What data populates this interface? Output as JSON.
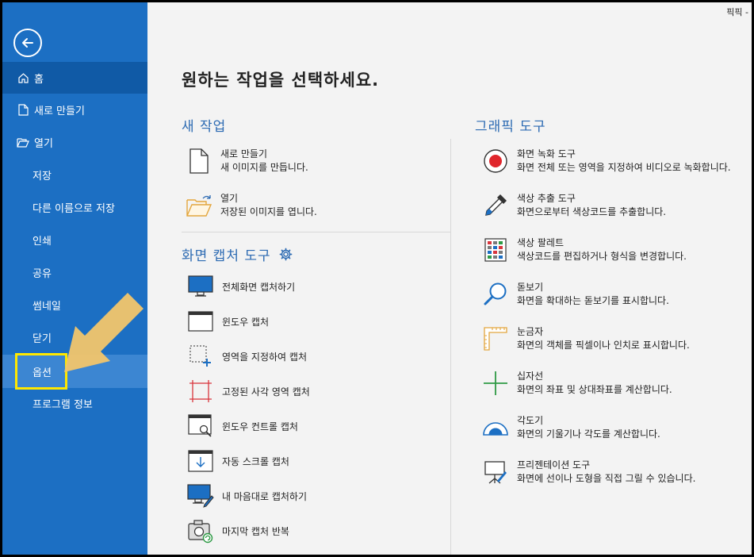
{
  "window": {
    "title": "픽픽 -"
  },
  "sidebar": {
    "items": [
      {
        "label": "홈",
        "icon": "home-icon"
      },
      {
        "label": "새로 만들기",
        "icon": "new-file-icon"
      },
      {
        "label": "열기",
        "icon": "folder-open-icon"
      },
      {
        "label": "저장"
      },
      {
        "label": "다른 이름으로 저장"
      },
      {
        "label": "인쇄"
      },
      {
        "label": "공유"
      },
      {
        "label": "썸네일"
      },
      {
        "label": "닫기"
      },
      {
        "label": "옵션"
      },
      {
        "label": "프로그램 정보"
      }
    ]
  },
  "main": {
    "page_title": "원하는 작업을 선택하세요.",
    "new_task": {
      "title": "새 작업",
      "items": [
        {
          "name": "새로 만들기",
          "desc": "새 이미지를 만듭니다."
        },
        {
          "name": "열기",
          "desc": "저장된 이미지를 엽니다."
        }
      ]
    },
    "capture": {
      "title": "화면 캡처 도구",
      "items": [
        {
          "name": "전체화면 캡처하기"
        },
        {
          "name": "윈도우 캡처"
        },
        {
          "name": "영역을 지정하여 캡처"
        },
        {
          "name": "고정된 사각 영역 캡처"
        },
        {
          "name": "윈도우 컨트롤 캡처"
        },
        {
          "name": "자동 스크롤 캡처"
        },
        {
          "name": "내 마음대로 캡처하기"
        },
        {
          "name": "마지막 캡처 반복"
        }
      ]
    },
    "graphic": {
      "title": "그래픽 도구",
      "items": [
        {
          "name": "화면 녹화 도구",
          "desc": "화면 전체 또는 영역을 지정하여 비디오로 녹화합니다."
        },
        {
          "name": "색상 추출 도구",
          "desc": "화면으로부터 색상코드를 추출합니다."
        },
        {
          "name": "색상 팔레트",
          "desc": "색상코드를 편집하거나 형식을 변경합니다."
        },
        {
          "name": "돋보기",
          "desc": "화면을 확대하는 돋보기를 표시합니다."
        },
        {
          "name": "눈금자",
          "desc": "화면의 객체를 픽셀이나 인치로 표시합니다."
        },
        {
          "name": "십자선",
          "desc": "화면의 좌표 및 상대좌표를 계산합니다."
        },
        {
          "name": "각도기",
          "desc": "화면의 기울기나 각도를 계산합니다."
        },
        {
          "name": "프리젠테이션 도구",
          "desc": "화면에 선이나 도형을 직접 그릴 수 있습니다."
        }
      ]
    }
  },
  "colors": {
    "sidebar": "#1c6fc3",
    "active": "#105aa6",
    "accent": "#2d6bb3",
    "highlight": "#ffe800",
    "arrow": "#f2c56b"
  }
}
